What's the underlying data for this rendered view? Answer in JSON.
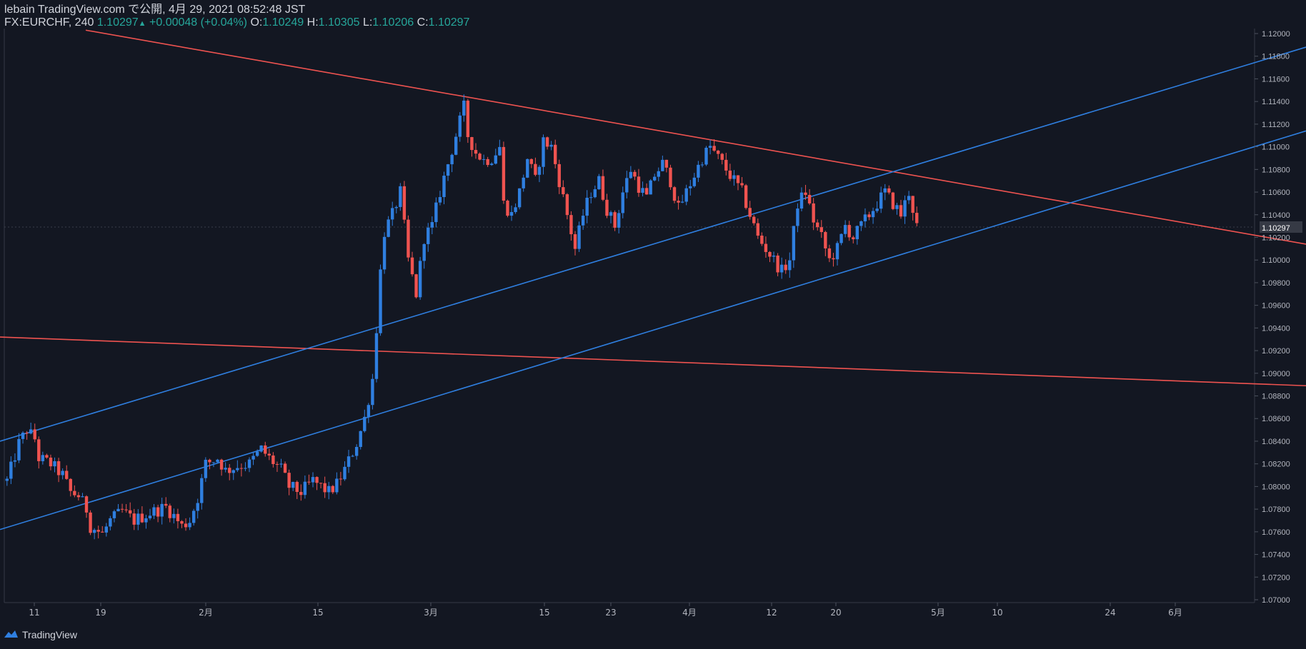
{
  "header": {
    "line1": "lebain TradingView.com で公開, 4月 29, 2021 08:52:48 JST",
    "symbol": "FX:EURCHF, 240",
    "last": "1.10297",
    "change": "+0.00048 (+0.04%)",
    "o_label": "O:",
    "o_value": "1.10249",
    "h_label": "H:",
    "h_value": "1.10305",
    "l_label": "L:",
    "l_value": "1.10206",
    "c_label": "C:",
    "c_value": "1.10297"
  },
  "footer": {
    "brand": "TradingView",
    "logo_icon": "tradingview-cloud-icon"
  },
  "colors": {
    "background": "#131722",
    "up": "#2f7fe0",
    "down": "#ef5350",
    "text": "#d1d4dc",
    "accent": "#26a69a",
    "channel_red": "#ef5350",
    "channel_blue": "#2f7fe0"
  },
  "chart_data": {
    "type": "candlestick",
    "x_ticks": [
      "11",
      "19",
      "2月",
      "15",
      "3月",
      "15",
      "23",
      "4月",
      "12",
      "20",
      "5月",
      "10",
      "24",
      "6月"
    ],
    "y_ticks": [
      "1.12000",
      "1.11800",
      "1.11600",
      "1.11400",
      "1.11200",
      "1.11000",
      "1.10800",
      "1.10600",
      "1.10400",
      "1.10200",
      "1.10000",
      "1.09800",
      "1.09600",
      "1.09400",
      "1.09200",
      "1.09000",
      "1.08800",
      "1.08600",
      "1.08400",
      "1.08200",
      "1.08000",
      "1.07800",
      "1.07600",
      "1.07400",
      "1.07200",
      "1.07000"
    ],
    "ylim": [
      1.07,
      1.12
    ],
    "last_price": "1.10297",
    "price_path": [
      [
        0,
        1.0805
      ],
      [
        3,
        1.0838
      ],
      [
        5,
        1.085
      ],
      [
        7,
        1.0842
      ],
      [
        8,
        1.0825
      ],
      [
        11,
        1.082
      ],
      [
        14,
        1.081
      ],
      [
        16,
        1.0795
      ],
      [
        18,
        1.0792
      ],
      [
        20,
        1.078
      ],
      [
        21,
        1.0765
      ],
      [
        24,
        1.0758
      ],
      [
        26,
        1.077
      ],
      [
        29,
        1.0778
      ],
      [
        32,
        1.077
      ],
      [
        35,
        1.0775
      ],
      [
        37,
        1.0778
      ],
      [
        40,
        1.0782
      ],
      [
        42,
        1.0774
      ],
      [
        44,
        1.0765
      ],
      [
        46,
        1.077
      ],
      [
        48,
        1.079
      ],
      [
        50,
        1.082
      ],
      [
        53,
        1.0825
      ],
      [
        55,
        1.0814
      ],
      [
        58,
        1.0818
      ],
      [
        61,
        1.082
      ],
      [
        64,
        1.0833
      ],
      [
        66,
        1.0825
      ],
      [
        69,
        1.0815
      ],
      [
        71,
        1.08
      ],
      [
        74,
        1.0795
      ],
      [
        77,
        1.0805
      ],
      [
        79,
        1.08
      ],
      [
        81,
        1.0795
      ],
      [
        83,
        1.0802
      ],
      [
        85,
        1.0815
      ],
      [
        88,
        1.0838
      ],
      [
        90,
        1.086
      ],
      [
        92,
        1.0895
      ],
      [
        93,
        1.094
      ],
      [
        94,
        1.099
      ],
      [
        95,
        1.1025
      ],
      [
        97,
        1.104
      ],
      [
        99,
        1.106
      ],
      [
        100,
        1.103
      ],
      [
        101,
        1.1
      ],
      [
        103,
        1.097
      ],
      [
        105,
        1.102
      ],
      [
        107,
        1.103
      ],
      [
        109,
        1.106
      ],
      [
        111,
        1.1085
      ],
      [
        113,
        1.111
      ],
      [
        115,
        1.1135
      ],
      [
        116,
        1.111
      ],
      [
        118,
        1.1095
      ],
      [
        120,
        1.1088
      ],
      [
        122,
        1.109
      ],
      [
        124,
        1.11
      ],
      [
        125,
        1.105
      ],
      [
        127,
        1.104
      ],
      [
        129,
        1.106
      ],
      [
        131,
        1.109
      ],
      [
        133,
        1.107
      ],
      [
        135,
        1.1105
      ],
      [
        137,
        1.11
      ],
      [
        139,
        1.107
      ],
      [
        141,
        1.104
      ],
      [
        143,
        1.101
      ],
      [
        145,
        1.104
      ],
      [
        147,
        1.106
      ],
      [
        149,
        1.107
      ],
      [
        151,
        1.1045
      ],
      [
        153,
        1.103
      ],
      [
        155,
        1.106
      ],
      [
        157,
        1.108
      ],
      [
        159,
        1.1065
      ],
      [
        161,
        1.1055
      ],
      [
        163,
        1.1075
      ],
      [
        165,
        1.1085
      ],
      [
        167,
        1.107
      ],
      [
        169,
        1.1045
      ],
      [
        171,
        1.106
      ],
      [
        173,
        1.1075
      ],
      [
        175,
        1.109
      ],
      [
        177,
        1.11
      ],
      [
        179,
        1.109
      ],
      [
        181,
        1.108
      ],
      [
        183,
        1.107
      ],
      [
        185,
        1.106
      ],
      [
        187,
        1.104
      ],
      [
        189,
        1.102
      ],
      [
        191,
        1.101
      ],
      [
        193,
        1.1
      ],
      [
        195,
        1.099
      ],
      [
        197,
        1.1
      ],
      [
        199,
        1.105
      ],
      [
        201,
        1.106
      ],
      [
        203,
        1.1035
      ],
      [
        205,
        1.102
      ],
      [
        207,
        1.1
      ],
      [
        209,
        1.101
      ],
      [
        211,
        1.103
      ],
      [
        213,
        1.102
      ],
      [
        215,
        1.103
      ],
      [
        217,
        1.104
      ],
      [
        219,
        1.105
      ],
      [
        221,
        1.106
      ],
      [
        223,
        1.105
      ],
      [
        225,
        1.104
      ],
      [
        227,
        1.106
      ],
      [
        229,
        1.103
      ]
    ],
    "channels": [
      {
        "color": "red",
        "points": [
          [
            120,
            1.1203
          ],
          [
            1828,
            1.1014
          ]
        ]
      },
      {
        "color": "red",
        "points": [
          [
            0,
            1.0932
          ],
          [
            1828,
            1.0889
          ]
        ]
      },
      {
        "color": "blue",
        "points": [
          [
            0,
            1.084
          ],
          [
            1828,
            1.1188
          ]
        ]
      },
      {
        "color": "blue",
        "points": [
          [
            0,
            1.0762
          ],
          [
            1828,
            1.1114
          ]
        ]
      }
    ]
  }
}
